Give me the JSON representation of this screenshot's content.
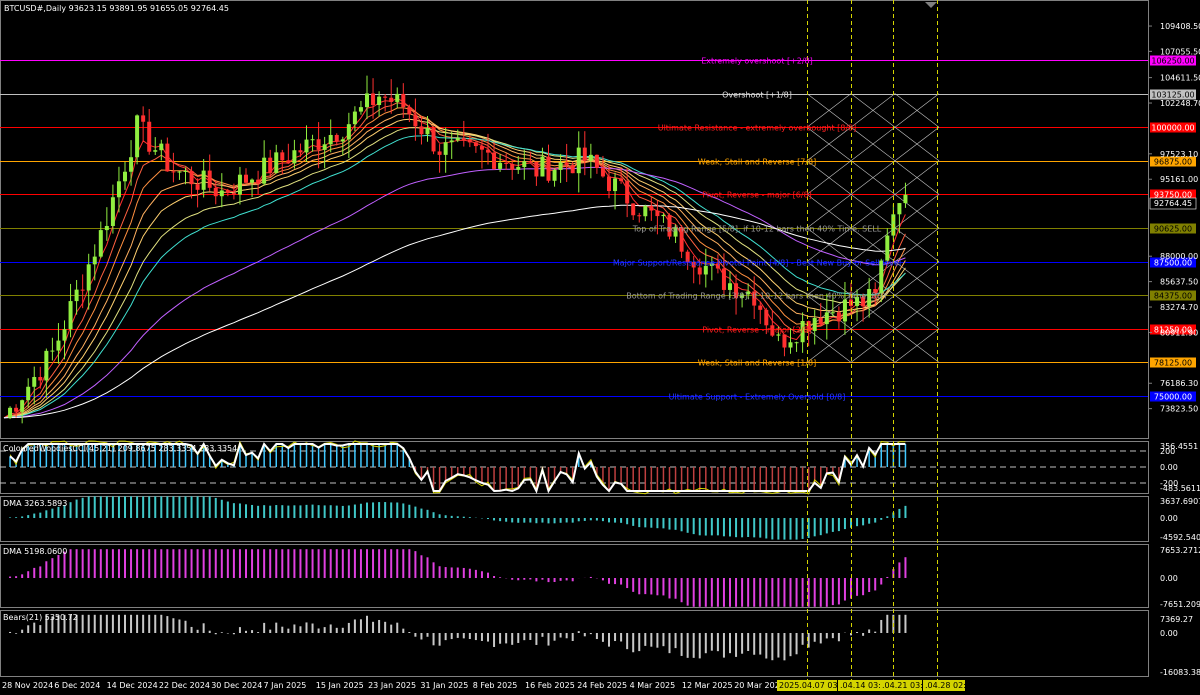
{
  "main": {
    "header": "BTCUSD#,Daily  93623.15 93891.95 91655.05 92764.45",
    "current_price": "92764.45",
    "price_ticks": [
      "109408.50",
      "107055.50",
      "104611.50",
      "102248.70",
      "97523.10",
      "95161.00",
      "88000.00",
      "85637.50",
      "83274.70",
      "80911.90",
      "76186.30",
      "73823.50"
    ],
    "murrey_levels": [
      {
        "price_label": "106250.00",
        "text": "Extremely overshoot [+2/8]",
        "color": "#ff00ff",
        "label_color": "#ff00ff"
      },
      {
        "price_label": "103125.00",
        "text": "Overshoot [+1/8]",
        "color": "#c0c0c0",
        "label_color": "#e0e0e0"
      },
      {
        "price_label": "100000.00",
        "text": "Ultimate Resistance - extremely overbought [8/8]",
        "color": "#ff0000",
        "label_color": "#ff2020"
      },
      {
        "price_label": "96875.00",
        "text": "Weak, Stall and Reverse [7/8]",
        "color": "#ffa500",
        "label_color": "#ffa500"
      },
      {
        "price_label": "93750.00",
        "text": "Pivot, Reverse - major [6/8]",
        "color": "#ff0000",
        "label_color": "#ff2020"
      },
      {
        "price_label": "90625.00",
        "text": "Top of Trading Range [5/8], if 10-12 bars then 40% Time. SELL",
        "color": "#808000",
        "label_color": "#999999"
      },
      {
        "price_label": "87500.00",
        "text": "Major Support/Resistance Pivotal Point [4/8] - Best New Buy or Sell level",
        "color": "#0000ff",
        "label_color": "#2a3cff"
      },
      {
        "price_label": "84375.00",
        "text": "Bottom of Trading Range [3/8], if 10-12 bars then 40% Time. BUY",
        "color": "#808000",
        "label_color": "#999999"
      },
      {
        "price_label": "81250.00",
        "text": "Pivot, Reverse - major [2/8]",
        "color": "#ff0000",
        "label_color": "#ff2020"
      },
      {
        "price_label": "78125.00",
        "text": "Weak, Stall and Reverse [1/8]",
        "color": "#ffa500",
        "label_color": "#ffa500"
      },
      {
        "price_label": "75000.00",
        "text": "Ultimate Support - Extremely Oversold [0/8]",
        "color": "#0000ff",
        "label_color": "#2a3cff"
      }
    ]
  },
  "cci": {
    "title": "ColouredWoodiesCCI(45,21) 209.8675 283.3354 283.3354",
    "ticks": [
      "356.4551",
      "200",
      "0.00",
      "-200",
      "-483.5611"
    ]
  },
  "dma1": {
    "title": "DMA 3263.5893",
    "ticks": [
      "3637.6907",
      "0.00",
      "-4592.5402"
    ],
    "color": "#40c8c8"
  },
  "dma2": {
    "title": "DMA 5198.0600",
    "ticks": [
      "7653.2712",
      "0.00",
      "-7651.2095"
    ],
    "color": "#e040e0"
  },
  "bears": {
    "title": "Bears(21) 5350.72",
    "ticks": [
      "7369.27",
      "0.00",
      "-16083.38"
    ]
  },
  "time_axis": {
    "labels": [
      "28 Nov 2024",
      "6 Dec 2024",
      "14 Dec 2024",
      "22 Dec 2024",
      "30 Dec 2024",
      "7 Jan 2025",
      "15 Jan 2025",
      "23 Jan 2025",
      "31 Jan 2025",
      "8 Feb 2025",
      "16 Feb 2025",
      "24 Feb 2025",
      "4 Mar 2025",
      "12 Mar 2025",
      "20 Mar 2025",
      "28 Mar 20"
    ],
    "highlighted": [
      "2025.04.07 03:00",
      ".04.14 03:00",
      ".04.21 03:00",
      ".04.28 02:59"
    ]
  }
}
